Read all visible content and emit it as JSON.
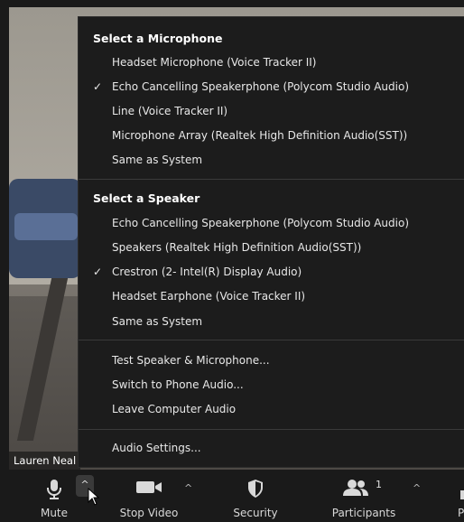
{
  "participant_name": "Lauren Neal",
  "menu": {
    "microphone_title": "Select a Microphone",
    "microphones": [
      {
        "label": "Headset Microphone (Voice Tracker II)",
        "selected": false
      },
      {
        "label": "Echo Cancelling Speakerphone (Polycom Studio Audio)",
        "selected": true
      },
      {
        "label": "Line (Voice Tracker II)",
        "selected": false
      },
      {
        "label": "Microphone Array (Realtek High Definition Audio(SST))",
        "selected": false
      },
      {
        "label": "Same as System",
        "selected": false
      }
    ],
    "speaker_title": "Select a Speaker",
    "speakers": [
      {
        "label": "Echo Cancelling Speakerphone (Polycom Studio Audio)",
        "selected": false
      },
      {
        "label": "Speakers (Realtek High Definition Audio(SST))",
        "selected": false
      },
      {
        "label": "Crestron (2- Intel(R) Display Audio)",
        "selected": true
      },
      {
        "label": "Headset Earphone (Voice Tracker II)",
        "selected": false
      },
      {
        "label": "Same as System",
        "selected": false
      }
    ],
    "actions": [
      "Test Speaker & Microphone...",
      "Switch to Phone Audio...",
      "Leave Computer Audio"
    ],
    "settings": "Audio Settings...",
    "check_glyph": "✓"
  },
  "toolbar": {
    "mute_label": "Mute",
    "stop_video_label": "Stop Video",
    "security_label": "Security",
    "participants_label": "Participants",
    "participants_count": "1",
    "next_label": "P",
    "caret_glyph": "^"
  },
  "colors": {
    "menu_bg": "#1c1c1c",
    "toolbar_bg": "#1a1a1a",
    "text": "#e8e8e8"
  }
}
